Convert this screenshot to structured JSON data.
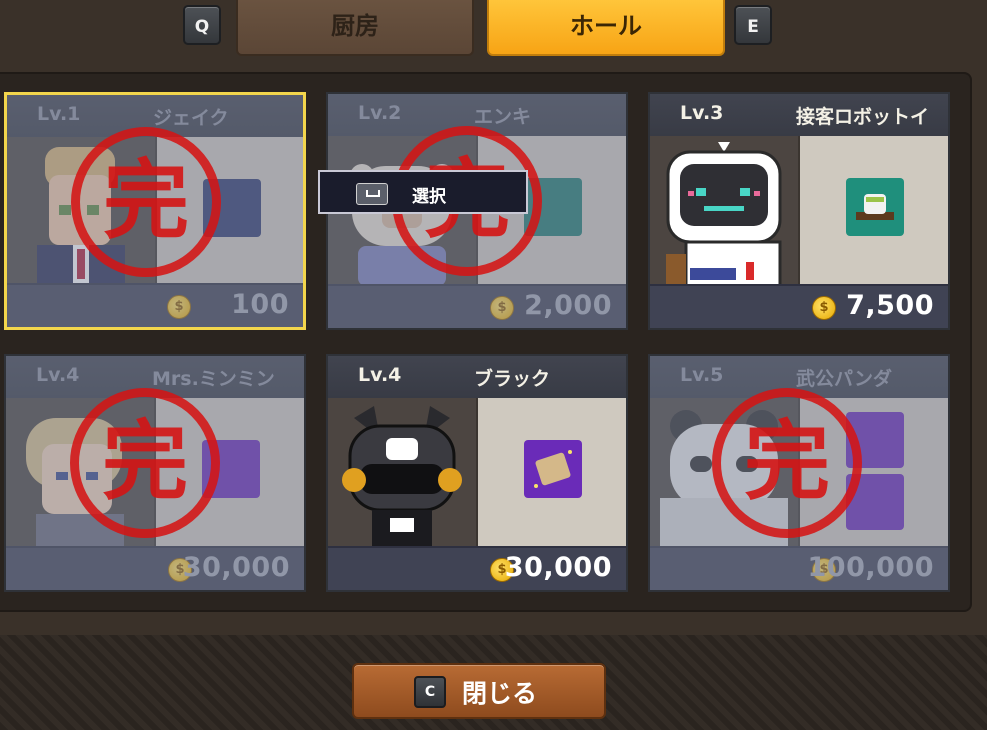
{
  "tabs": {
    "prev_key": "Q",
    "next_key": "E",
    "items": [
      {
        "label": "厨房",
        "active": false
      },
      {
        "label": "ホール",
        "active": true
      }
    ]
  },
  "tooltip": {
    "key_icon": "space-key-icon",
    "label": "選択"
  },
  "cards": [
    {
      "level": "Lv.1",
      "name": "ジェイク",
      "price": "100",
      "completed": true,
      "selected": true,
      "stamp": "完",
      "skill_color": "#2f3a6e"
    },
    {
      "level": "Lv.2",
      "name": "エンキ",
      "price": "2,000",
      "completed": true,
      "selected": false,
      "stamp": "完",
      "skill_color": "#1f7b70"
    },
    {
      "level": "Lv.3",
      "name": "接客ロボットイ",
      "price": "7,500",
      "completed": false,
      "selected": false,
      "stamp": "",
      "skill_color": "#1f8f7c"
    },
    {
      "level": "Lv.4",
      "name": "Mrs.ミンミン",
      "price": "30,000",
      "completed": true,
      "selected": false,
      "stamp": "完",
      "skill_color": "#6a2bb8"
    },
    {
      "level": "Lv.4",
      "name": "ブラック",
      "price": "30,000",
      "completed": false,
      "selected": false,
      "stamp": "",
      "skill_color": "#6a2bb8"
    },
    {
      "level": "Lv.5",
      "name": "武公パンダ",
      "price": "100,000",
      "completed": true,
      "selected": false,
      "stamp": "完",
      "skill_color": "#6a2bb8"
    }
  ],
  "close_button": {
    "key": "C",
    "label": "閉じる"
  },
  "colors": {
    "active_tab": "#f7a415",
    "stamp_red": "#d41414",
    "selected_border": "#f3d64c"
  }
}
